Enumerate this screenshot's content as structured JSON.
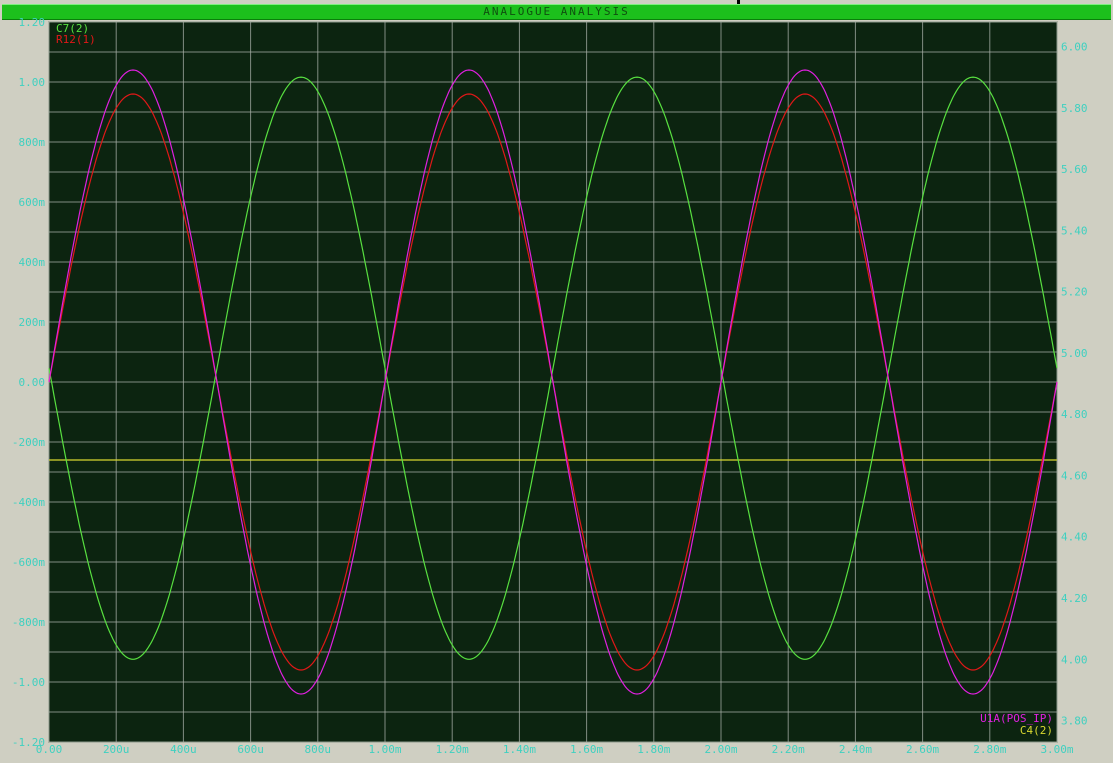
{
  "window": {
    "title": "ANALOGUE ANALYSIS"
  },
  "colors": {
    "background": "#0c2410",
    "grid": "#a8b0a8",
    "axis_text": "#3fd0c0",
    "trace_magenta": "#e020e0",
    "trace_red": "#e01818",
    "trace_green": "#58e040",
    "trace_yellow": "#d8d830"
  },
  "chart_data": {
    "type": "line",
    "title": "ANALOGUE ANALYSIS",
    "xlabel": "",
    "ylabel": "",
    "x_ticks": [
      "0.00",
      "200u",
      "400u",
      "600u",
      "800u",
      "1.00m",
      "1.20m",
      "1.40m",
      "1.60m",
      "1.80m",
      "2.00m",
      "2.20m",
      "2.40m",
      "2.60m",
      "2.80m",
      "3.00m"
    ],
    "xlim": [
      0,
      0.003
    ],
    "y_left_ticks": [
      "1.20",
      "1.00",
      "800m",
      "600m",
      "400m",
      "200m",
      "0.00",
      "-200m",
      "-400m",
      "-600m",
      "-800m",
      "-1.00",
      "-1.20"
    ],
    "ylim_left": [
      -1.2,
      1.2
    ],
    "y_right_ticks": [
      "6.00",
      "5.80",
      "5.60",
      "5.40",
      "5.20",
      "5.00",
      "4.80",
      "4.60",
      "4.40",
      "4.20",
      "4.00",
      "3.80"
    ],
    "ylim_right": [
      3.73,
      6.08
    ],
    "grid": true,
    "legend": [
      {
        "label": "C7(2)",
        "color": "#58e040",
        "position": "top-left"
      },
      {
        "label": "R12(1)",
        "color": "#e01818",
        "position": "top-left"
      },
      {
        "label": "U1A(POS_IP)",
        "color": "#e020e0",
        "position": "bottom-right"
      },
      {
        "label": "C4(2)",
        "color": "#d8d830",
        "position": "bottom-right"
      }
    ],
    "series": [
      {
        "name": "R12(1)",
        "axis": "left",
        "kind": "sine",
        "amplitude": 0.96,
        "offset": 0.0,
        "frequency_hz": 1000,
        "phase_deg": 0
      },
      {
        "name": "U1A(POS_IP)",
        "axis": "left",
        "kind": "sine",
        "amplitude": 1.04,
        "offset": 0.0,
        "frequency_hz": 1000,
        "phase_deg": 0
      },
      {
        "name": "C7(2)",
        "axis": "right",
        "kind": "sine",
        "amplitude": 0.95,
        "offset": 4.95,
        "frequency_hz": 1000,
        "phase_deg": 180
      },
      {
        "name": "C4(2)",
        "axis": "left",
        "kind": "constant",
        "value": -0.26
      }
    ]
  }
}
